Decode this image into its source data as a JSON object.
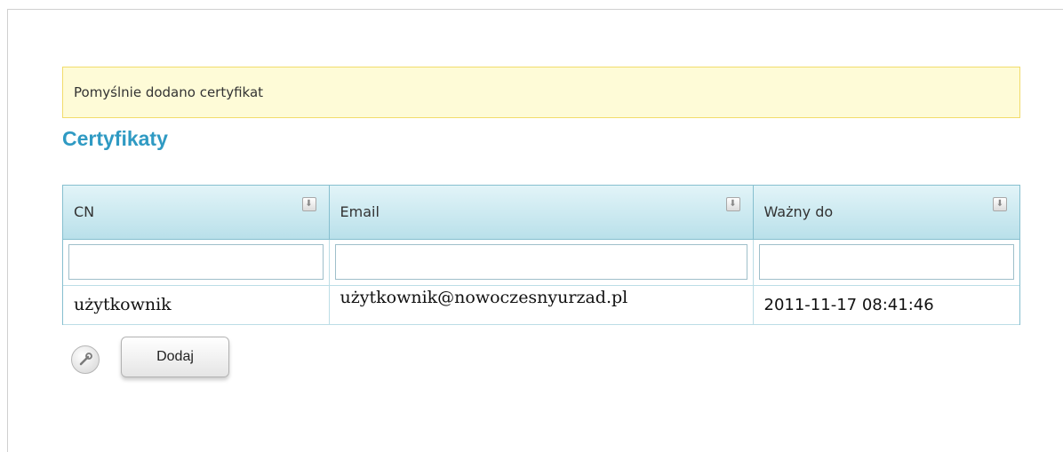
{
  "notice": {
    "text": "Pomyślnie dodano certyfikat"
  },
  "section": {
    "title": "Certyfikaty"
  },
  "table": {
    "columns": [
      "CN",
      "Email",
      "Ważny do"
    ],
    "rows": [
      [
        "użytkownik",
        "użytkownik@nowoczesnyurzad.pl",
        "2011-11-17 08:41:46"
      ]
    ]
  },
  "toolbar": {
    "add_label": "Dodaj",
    "settings_icon": "wrench-icon"
  },
  "colors": {
    "title": "#2f9ac3",
    "notice_bg": "#fefbd7",
    "notice_border": "#f2dc6b",
    "header_border": "#86bfcf"
  }
}
